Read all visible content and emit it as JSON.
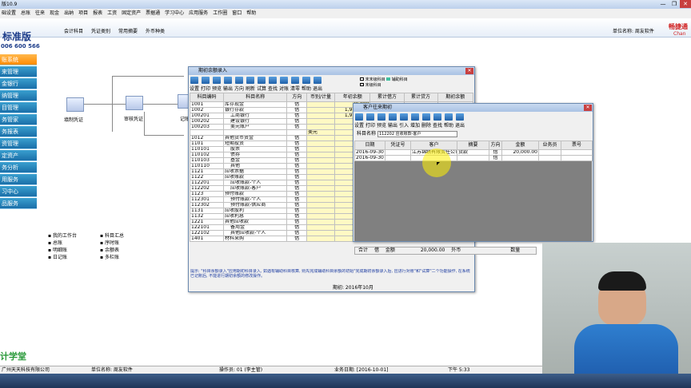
{
  "titlebar": {
    "title": "版10.9",
    "min": "—",
    "max": "❐",
    "close": "✕"
  },
  "menubar": [
    "础设置",
    "总账",
    "往来",
    "现金",
    "出纳",
    "项目",
    "报表",
    "工资",
    "固定资产",
    "票据通",
    "学习中心",
    "应用服务",
    "工作圈",
    "窗口",
    "帮助"
  ],
  "header": {
    "edition": "标准版",
    "phone": "006 600 566",
    "tabs": [
      "会计科目",
      "凭证类别",
      "常用摘要",
      "外币种类"
    ],
    "unit": "单位名称: 周友软件",
    "brand": "畅捷通",
    "brand2": "Chan"
  },
  "leftnav": [
    "账系统",
    "来管理",
    "金银行",
    "纳管理",
    "目管理",
    "务管家",
    "务报表",
    "资管理",
    "定资产",
    "务分析",
    "用服务",
    "习中心",
    "品服务"
  ],
  "bottomlogo": "计学堂",
  "flow": [
    {
      "label": "填制凭证"
    },
    {
      "label": "审核凭证"
    },
    {
      "label": "记账"
    }
  ],
  "links": {
    "col1": [
      "我的工作台",
      "总账",
      "明细账",
      "日记账"
    ],
    "col2": [
      "科目汇总",
      "序时账",
      "余额表",
      "多栏账"
    ]
  },
  "statusbar": {
    "company": "广州天天科技有限公司",
    "unit": "单位名称: 周友软件",
    "operator": "操作员: 01 (李主管)",
    "date": "业务日期: [2016-10-01]",
    "time": "下午 5:33"
  },
  "dlg1": {
    "title": "期初余额录入",
    "toolbar": [
      "设置",
      "打印",
      "预览",
      "输出",
      "方向",
      "刷新",
      "试算",
      "查找",
      "对账",
      "清零",
      "帮助",
      "退出"
    ],
    "legend": [
      "末末级科目",
      "辅助科目",
      "末级科目"
    ],
    "columns": [
      "科目编码",
      "科目名称",
      "方向",
      "币别/计量",
      "年初余额",
      "累计借方",
      "累计贷方",
      "期初余额"
    ],
    "rows": [
      [
        "1001",
        "库存现金",
        "借",
        "",
        "20,000"
      ],
      [
        "1002",
        "银行存款",
        "借",
        "",
        "1,918,225"
      ],
      [
        "100201",
        "工商银行",
        "借",
        "",
        "1,918,225"
      ],
      [
        "100202",
        "建设银行",
        "借",
        "",
        ""
      ],
      [
        "100203",
        "美元账户",
        "借",
        "",
        ""
      ],
      [
        "",
        "",
        "",
        "美元",
        ""
      ],
      [
        "1012",
        "其他货币资金",
        "借",
        "",
        ""
      ],
      [
        "1101",
        "短期投资",
        "借",
        "",
        ""
      ],
      [
        "110101",
        "股票",
        "借",
        "",
        ""
      ],
      [
        "110102",
        "债券",
        "借",
        "",
        ""
      ],
      [
        "110103",
        "基金",
        "借",
        "",
        ""
      ],
      [
        "110110",
        "其他",
        "借",
        "",
        ""
      ],
      [
        "1121",
        "应收票据",
        "借",
        "",
        ""
      ],
      [
        "1122",
        "应收账款",
        "借",
        "",
        ""
      ],
      [
        "112201",
        "应收账款-个人",
        "借",
        "",
        ""
      ],
      [
        "112202",
        "应收账款-客户",
        "借",
        "",
        ""
      ],
      [
        "1123",
        "预付账款",
        "借",
        "",
        ""
      ],
      [
        "112301",
        "预付账款-个人",
        "借",
        "",
        ""
      ],
      [
        "112302",
        "预付账款-供应商",
        "借",
        "",
        ""
      ],
      [
        "1131",
        "应收股利",
        "借",
        "",
        ""
      ],
      [
        "1132",
        "应收利息",
        "借",
        "",
        ""
      ],
      [
        "1221",
        "其他应收款",
        "借",
        "",
        ""
      ],
      [
        "122101",
        "备用金",
        "借",
        "",
        ""
      ],
      [
        "122102",
        "其他应收款-个人",
        "借",
        "",
        ""
      ],
      [
        "1401",
        "材料采购",
        "借",
        "",
        ""
      ]
    ],
    "hint": "提示: \"科目余额录入\"应用期初科目录入, 如遇有辅助科目核算, 则先完成辅助科目余额的初始\"完成期初余额录入后, 应进行对账\"和\"试算\"二个功能操作, 在系统已记账后, 不能进行期初余额的修改操作。",
    "period": "期初: 2016年10月"
  },
  "dlg2": {
    "title": "客户往来期初",
    "toolbar": [
      "设置",
      "打印",
      "预览",
      "输出",
      "引入",
      "增加",
      "删除",
      "查找",
      "帮助",
      "退出"
    ],
    "subject_label": "科目名称",
    "subject_value": "112202 应收账款-客户",
    "columns": [
      "日期",
      "凭证号",
      "客户",
      "摘要",
      "方向",
      "金额",
      "业务员",
      "票号"
    ],
    "rows": [
      [
        "2016-09-30",
        "",
        "江苏锦绣有限责任公司",
        "货款",
        "借",
        "20,000.00",
        "",
        ""
      ],
      [
        "2016-09-30",
        "",
        "",
        "",
        "借",
        "",
        "",
        ""
      ]
    ],
    "footer": {
      "label": "合计",
      "dir": "借",
      "amount_label": "金额",
      "amount": "20,000.00",
      "fx": "外币",
      "qty": "数量"
    }
  }
}
